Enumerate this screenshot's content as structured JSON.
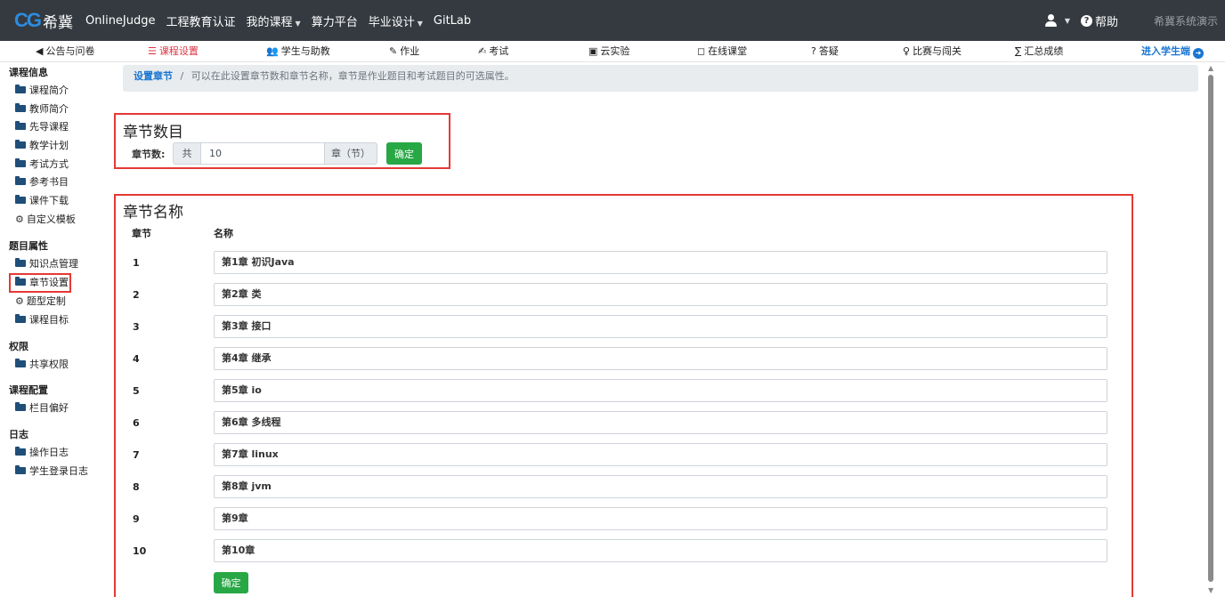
{
  "topbar": {
    "logo_mark": "CG",
    "logo_text": "希冀",
    "items": [
      {
        "label": "OnlineJudge",
        "dropdown": false
      },
      {
        "label": "工程教育认证",
        "dropdown": false
      },
      {
        "label": "我的课程",
        "dropdown": true
      },
      {
        "label": "算力平台",
        "dropdown": false
      },
      {
        "label": "毕业设计",
        "dropdown": true
      },
      {
        "label": "GitLab",
        "dropdown": false
      }
    ],
    "help_label": "帮助",
    "demo_label": "希冀系统演示"
  },
  "subnav": {
    "items": [
      {
        "label": "公告与问卷",
        "icon": "megaphone-icon",
        "glyph": "◀"
      },
      {
        "label": "课程设置",
        "icon": "list-icon",
        "glyph": "☰",
        "active": true
      },
      {
        "label": "学生与助教",
        "icon": "users-icon",
        "glyph": "👥"
      },
      {
        "label": "作业",
        "icon": "homework-icon",
        "glyph": "✎"
      },
      {
        "label": "考试",
        "icon": "exam-icon",
        "glyph": "✍"
      },
      {
        "label": "云实验",
        "icon": "monitor-icon",
        "glyph": "▣"
      },
      {
        "label": "在线课堂",
        "icon": "classroom-icon",
        "glyph": "◻"
      },
      {
        "label": "答疑",
        "icon": "question-icon",
        "glyph": "?"
      },
      {
        "label": "比赛与闯关",
        "icon": "trophy-icon",
        "glyph": "♀"
      },
      {
        "label": "汇总成绩",
        "icon": "sigma-icon",
        "glyph": "∑"
      }
    ],
    "enter_student": "进入学生端"
  },
  "sidebar": {
    "sections": [
      {
        "title": "课程信息",
        "items": [
          {
            "label": "课程简介",
            "icon": "folder"
          },
          {
            "label": "教师简介",
            "icon": "folder"
          },
          {
            "label": "先导课程",
            "icon": "folder"
          },
          {
            "label": "教学计划",
            "icon": "folder"
          },
          {
            "label": "考试方式",
            "icon": "folder"
          },
          {
            "label": "参考书目",
            "icon": "folder"
          },
          {
            "label": "课件下载",
            "icon": "folder"
          },
          {
            "label": "自定义模板",
            "icon": "gears"
          }
        ]
      },
      {
        "title": "题目属性",
        "items": [
          {
            "label": "知识点管理",
            "icon": "folder"
          },
          {
            "label": "章节设置",
            "icon": "folder",
            "active": true
          },
          {
            "label": "题型定制",
            "icon": "gears"
          },
          {
            "label": "课程目标",
            "icon": "folder"
          }
        ]
      },
      {
        "title": "权限",
        "items": [
          {
            "label": "共享权限",
            "icon": "folder"
          }
        ]
      },
      {
        "title": "课程配置",
        "items": [
          {
            "label": "栏目偏好",
            "icon": "folder"
          }
        ]
      },
      {
        "title": "日志",
        "items": [
          {
            "label": "操作日志",
            "icon": "folder"
          },
          {
            "label": "学生登录日志",
            "icon": "folder"
          }
        ]
      }
    ]
  },
  "breadcrumb": {
    "link": "设置章节",
    "separator": "/",
    "text": "可以在此设置章节数和章节名称，章节是作业题目和考试题目的可选属性。"
  },
  "chapter_count": {
    "heading": "章节数目",
    "label": "章节数:",
    "prefix": "共",
    "value": "10",
    "suffix": "章（节）",
    "confirm": "确定"
  },
  "chapter_names": {
    "heading": "章节名称",
    "col_chapter": "章节",
    "col_name": "名称",
    "rows": [
      {
        "num": "1",
        "name": "第1章 初识Java"
      },
      {
        "num": "2",
        "name": "第2章 类"
      },
      {
        "num": "3",
        "name": "第3章 接口"
      },
      {
        "num": "4",
        "name": "第4章 继承"
      },
      {
        "num": "5",
        "name": "第5章 io"
      },
      {
        "num": "6",
        "name": "第6章 多线程"
      },
      {
        "num": "7",
        "name": "第7章 linux"
      },
      {
        "num": "8",
        "name": "第8章 jvm"
      },
      {
        "num": "9",
        "name": "第9章"
      },
      {
        "num": "10",
        "name": "第10章"
      }
    ],
    "confirm": "确定"
  }
}
